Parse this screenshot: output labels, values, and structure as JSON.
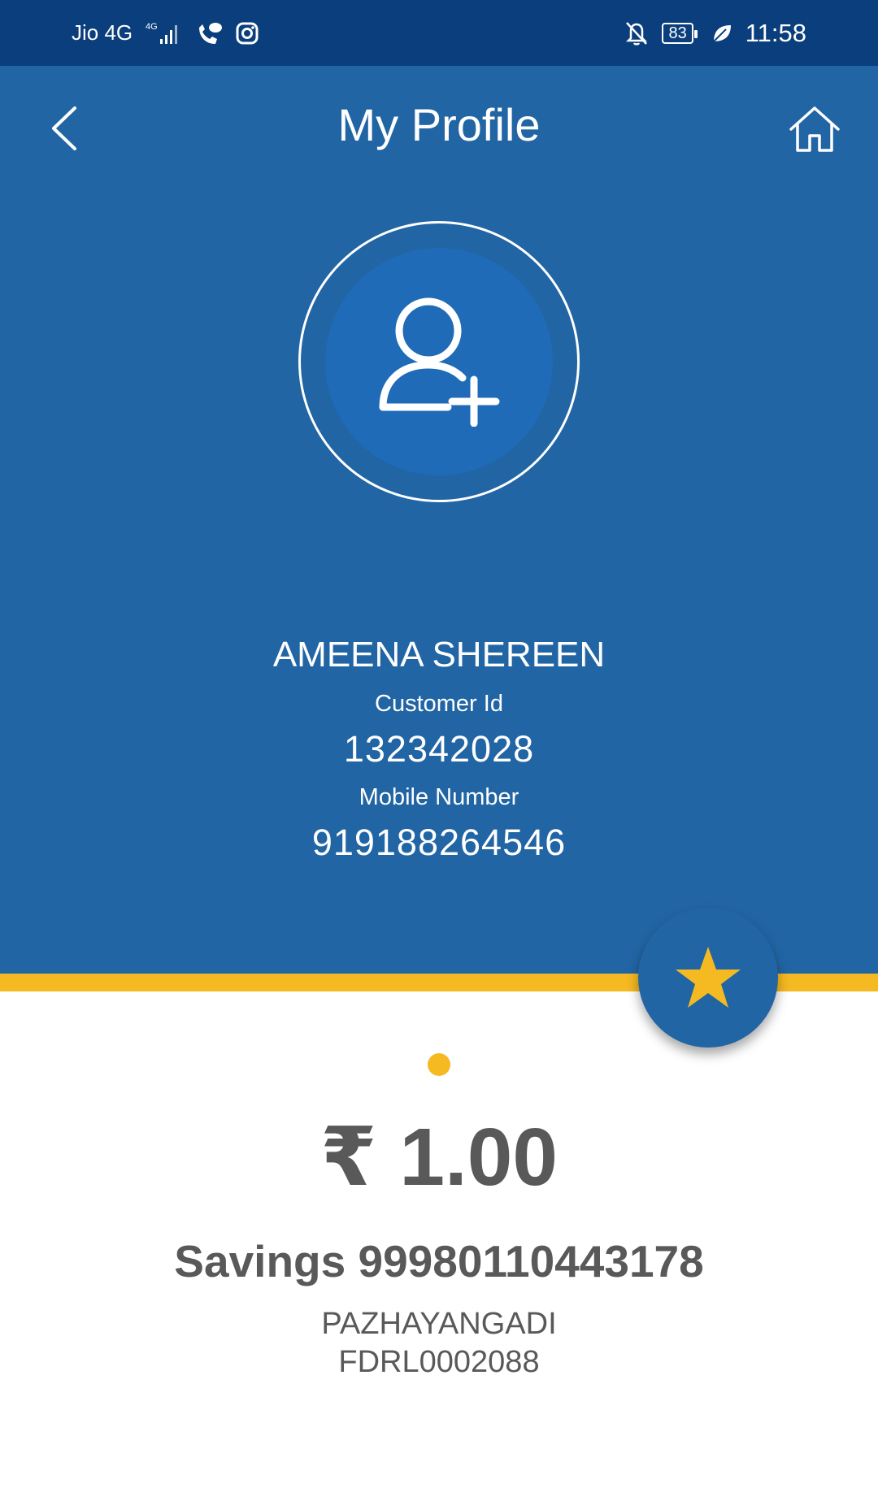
{
  "status_bar": {
    "carrier": "Jio 4G",
    "network_badge": "4G",
    "battery_level": "83",
    "time": "11:58",
    "icons": [
      "signal-icon",
      "wifi-calling-icon",
      "instagram-icon",
      "notifications-off-icon",
      "battery-icon",
      "leaf-icon"
    ]
  },
  "header": {
    "title": "My Profile",
    "back_icon": "chevron-left-icon",
    "home_icon": "home-icon"
  },
  "profile": {
    "avatar_icon": "add-user-icon",
    "name": "AMEENA SHEREEN",
    "customer_id_label": "Customer Id",
    "customer_id": "132342028",
    "mobile_label": "Mobile Number",
    "mobile": "919188264546"
  },
  "favorite": {
    "icon": "star-icon"
  },
  "account": {
    "balance": "₹ 1.00",
    "account_line": "Savings 99980110443178",
    "branch": "PAZHAYANGADI",
    "ifsc": "FDRL0002088"
  },
  "colors": {
    "status_bar": "#0a3e7c",
    "header": "#2165a4",
    "avatar_inner": "#1f6bb8",
    "accent_yellow": "#f5b921",
    "text_gray": "#595959"
  }
}
